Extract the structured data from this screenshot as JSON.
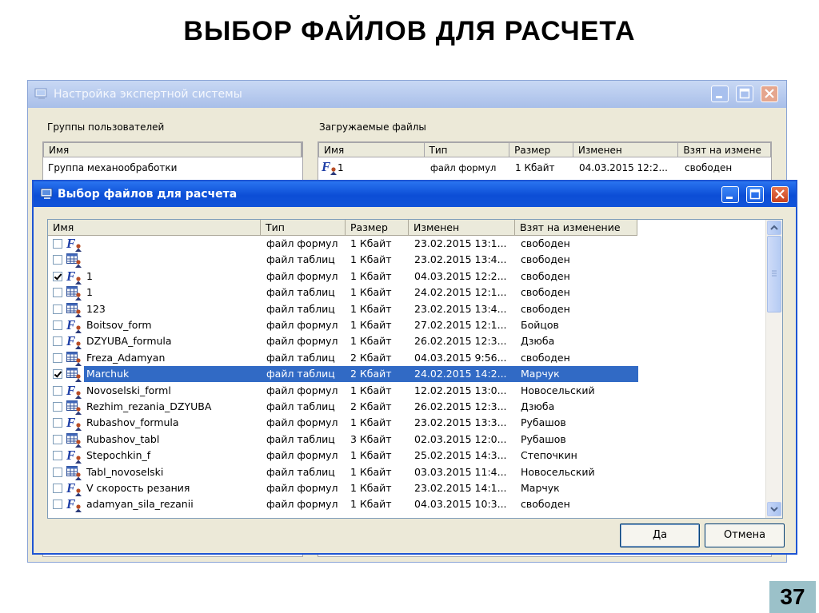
{
  "slide": {
    "title": "ВЫБОР ФАЙЛОВ ДЛЯ РАСЧЕТА",
    "page_number": "37"
  },
  "back_window": {
    "title": "Настройка экспертной системы",
    "left_group_label": "Группы пользователей",
    "left_columns": [
      "Имя"
    ],
    "left_rows": [
      "Группа механообработки"
    ],
    "right_group_label": "Загружаемые файлы",
    "right_columns": [
      "Имя",
      "Тип",
      "Размер",
      "Изменен",
      "Взят на измене"
    ],
    "right_rows": [
      {
        "name": "1",
        "type": "файл формул",
        "size": "1 Кбайт",
        "modified": "04.03.2015 12:2...",
        "owner": "свободен"
      }
    ]
  },
  "dialog": {
    "title": "Выбор файлов для расчета",
    "columns": [
      "Имя",
      "Тип",
      "Размер",
      "Изменен",
      "Взят на изменение"
    ],
    "rows": [
      {
        "checked": false,
        "icon": "formula-file-icon",
        "name": "",
        "type": "файл формул",
        "size": "1 Кбайт",
        "modified": "23.02.2015 13:1...",
        "owner": "свободен"
      },
      {
        "checked": false,
        "icon": "table-file-icon",
        "name": "",
        "type": "файл таблиц",
        "size": "1 Кбайт",
        "modified": "23.02.2015 13:4...",
        "owner": "свободен"
      },
      {
        "checked": true,
        "icon": "formula-file-icon",
        "name": "1",
        "type": "файл формул",
        "size": "1 Кбайт",
        "modified": "04.03.2015 12:2...",
        "owner": "свободен"
      },
      {
        "checked": false,
        "icon": "table-file-icon",
        "name": "1",
        "type": "файл таблиц",
        "size": "1 Кбайт",
        "modified": "24.02.2015 12:1...",
        "owner": "свободен"
      },
      {
        "checked": false,
        "icon": "table-file-icon",
        "name": "123",
        "type": "файл таблиц",
        "size": "1 Кбайт",
        "modified": "23.02.2015 13:4...",
        "owner": "свободен"
      },
      {
        "checked": false,
        "icon": "formula-file-icon",
        "name": "Boitsov_form",
        "type": "файл формул",
        "size": "1 Кбайт",
        "modified": "27.02.2015 12:1...",
        "owner": "Бойцов"
      },
      {
        "checked": false,
        "icon": "formula-file-icon",
        "name": "DZYUBA_formula",
        "type": "файл формул",
        "size": "1 Кбайт",
        "modified": "26.02.2015 12:3...",
        "owner": "Дзюба"
      },
      {
        "checked": false,
        "icon": "table-file-icon",
        "name": "Freza_Adamyan",
        "type": "файл таблиц",
        "size": "2 Кбайт",
        "modified": "04.03.2015 9:56...",
        "owner": "свободен"
      },
      {
        "checked": true,
        "icon": "table-file-icon",
        "name": "Marchuk",
        "type": "файл таблиц",
        "size": "2 Кбайт",
        "modified": "24.02.2015 14:2...",
        "owner": "Марчук",
        "selected": true
      },
      {
        "checked": false,
        "icon": "formula-file-icon",
        "name": "Novoselski_forml",
        "type": "файл формул",
        "size": "1 Кбайт",
        "modified": "12.02.2015 13:0...",
        "owner": "Новосельский"
      },
      {
        "checked": false,
        "icon": "table-file-icon",
        "name": "Rezhim_rezania_DZYUBA",
        "type": "файл таблиц",
        "size": "2 Кбайт",
        "modified": "26.02.2015 12:3...",
        "owner": "Дзюба"
      },
      {
        "checked": false,
        "icon": "formula-file-icon",
        "name": "Rubashov_formula",
        "type": "файл формул",
        "size": "1 Кбайт",
        "modified": "23.02.2015 13:3...",
        "owner": "Рубашов"
      },
      {
        "checked": false,
        "icon": "table-file-icon",
        "name": "Rubashov_tabl",
        "type": "файл таблиц",
        "size": "3 Кбайт",
        "modified": "02.03.2015 12:0...",
        "owner": "Рубашов"
      },
      {
        "checked": false,
        "icon": "formula-file-icon",
        "name": "Stepochkin_f",
        "type": "файл формул",
        "size": "1 Кбайт",
        "modified": "25.02.2015 14:3...",
        "owner": "Степочкин"
      },
      {
        "checked": false,
        "icon": "table-file-icon",
        "name": "Tabl_novoselski",
        "type": "файл таблиц",
        "size": "1 Кбайт",
        "modified": "03.03.2015 11:4...",
        "owner": "Новосельский"
      },
      {
        "checked": false,
        "icon": "formula-file-icon",
        "name": "V скорость резания",
        "type": "файл формул",
        "size": "1 Кбайт",
        "modified": "23.02.2015 14:1...",
        "owner": "Марчук"
      },
      {
        "checked": false,
        "icon": "formula-file-icon",
        "name": "adamyan_sila_rezanii",
        "type": "файл формул",
        "size": "1 Кбайт",
        "modified": "04.03.2015 10:3...",
        "owner": "свободен"
      }
    ],
    "ok_label": "Да",
    "cancel_label": "Отмена"
  },
  "colors": {
    "selection": "#316ac5",
    "xp_blue": "#0c4ed6",
    "dialog_bg": "#ece9d8",
    "page_badge": "#9bc1c9"
  }
}
